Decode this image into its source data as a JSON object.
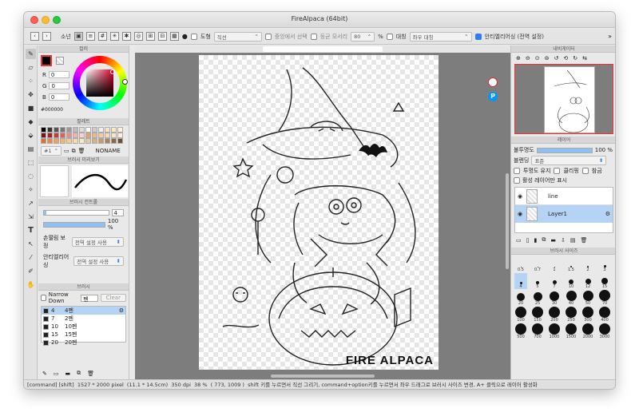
{
  "window": {
    "title": "FireAlpaca (64bit)"
  },
  "toolbar": {
    "mode_label": "소넌",
    "shape_label": "도형",
    "shape_select": "직선",
    "center_label": "중앙에서 선택",
    "equal_spacing_label": "등균 모서리",
    "percent_value": "80",
    "percent_sign": "%",
    "symmetry_label": "대칭",
    "symmetry_select": "좌우 대칭",
    "antialias_label": "안티엘리어싱 (전역 설정)"
  },
  "left_panel": {
    "color_header": "컬러",
    "r_label": "R",
    "r_value": "0",
    "g_label": "G",
    "g_value": "0",
    "b_label": "B",
    "b_value": "0",
    "hex_value": "#000000",
    "palette_header": "팔레트",
    "palette_select": "#1",
    "palette_name": "NONAME",
    "brush_preview_header": "브러시 미리보기",
    "brush_control_header": "브러시 컨트롤",
    "brush_size_value": "4",
    "brush_opacity_value": "100 %",
    "correction_label": "손떨림 보정",
    "correction_select": "전역 설정 사용",
    "antialias_label": "안티엘리어싱",
    "antialias_select": "전역 설정 사용",
    "brush_list_header": "브러시",
    "narrow_down_label": "Narrow Down",
    "narrow_down_value": "펜",
    "clear_label": "Clear",
    "brushes": [
      {
        "size": "4",
        "name": "4펜"
      },
      {
        "size": "7",
        "name": "2펜"
      },
      {
        "size": "10",
        "name": "10펜"
      },
      {
        "size": "15",
        "name": "15펜"
      },
      {
        "size": "20",
        "name": "20펜"
      }
    ]
  },
  "canvas": {
    "watermark": "FIRE ALPACA"
  },
  "right_panel": {
    "navigator_header": "내비게이터",
    "layers_header": "레이어",
    "opacity_label": "불투명도",
    "opacity_value": "100 %",
    "blend_label": "블렌딩",
    "blend_select": "표준",
    "protect_alpha_label": "투명도 유지",
    "clipping_label": "클리핑",
    "reference_label": "참금",
    "show_active_label": "활성 레이어만 표시",
    "layers": [
      {
        "name": "line"
      },
      {
        "name": "Layer1"
      }
    ],
    "brush_size_header": "브러시 사이즈",
    "brush_sizes": [
      "0.5",
      "0.7",
      "1",
      "1.5",
      "2",
      "3",
      "4",
      "5",
      "7",
      "10",
      "12",
      "15",
      "20",
      "25",
      "30",
      "40",
      "50",
      "70",
      "100",
      "150",
      "200",
      "250",
      "300",
      "400",
      "500",
      "700",
      "1000",
      "1500",
      "2000",
      "3000"
    ]
  },
  "status": {
    "keys": "[command] [shift]",
    "size": "1527 * 2000 pixel",
    "physical": "(11.1 * 14.5cm)",
    "dpi": "350 dpi",
    "zoom": "38 %",
    "coords": "( 773, 1009 )",
    "hint": "shift 키를 누르면서 직선 그리기, command+option키를 누르면서 좌우 드래그로 브러시 사이즈 변경, A+ 클릭으로 레이어 활성화"
  },
  "colors": {
    "selection_blue": "#b5d3f5",
    "slider_blue": "#8fc0f3",
    "accent": "#2f7cf6",
    "canvas_gray": "#7d7d7d"
  }
}
